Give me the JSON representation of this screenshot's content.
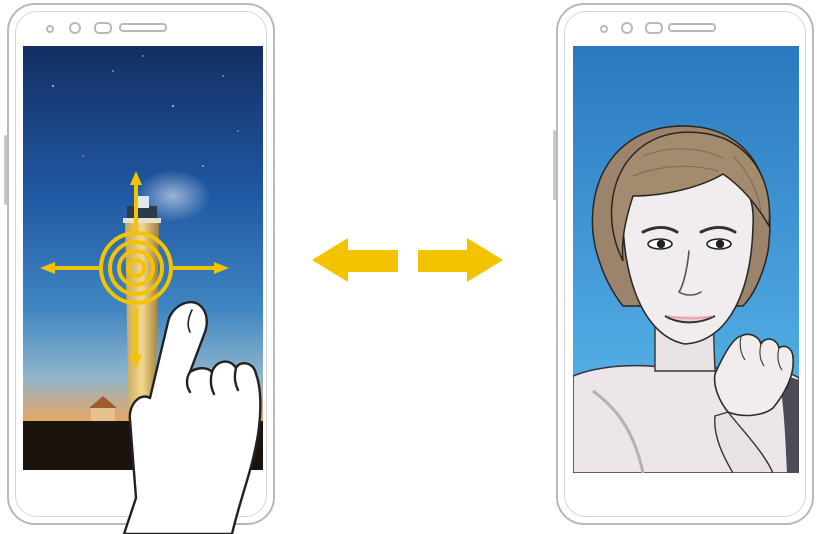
{
  "left_phone": {
    "screen": "rear-camera-scene",
    "scene": "lighthouse-at-dusk",
    "gesture": "touch-and-drag-focus",
    "icons": [
      "focus-ring-icon",
      "arrow-up-icon",
      "arrow-down-icon",
      "arrow-left-icon",
      "arrow-right-icon",
      "finger-icon"
    ]
  },
  "switch_arrows": {
    "icons": [
      "arrow-left-icon",
      "arrow-right-icon"
    ],
    "color": "#f3c300"
  },
  "right_phone": {
    "screen": "front-camera-selfie",
    "scene": "smiling-person-portrait"
  },
  "colors": {
    "accent": "#f3c300",
    "phone_outline": "#b9b9b9",
    "sky_top": "#1a3c7a",
    "sky_horizon": "#e0a566",
    "portrait_bg": "#2f8fd0"
  }
}
